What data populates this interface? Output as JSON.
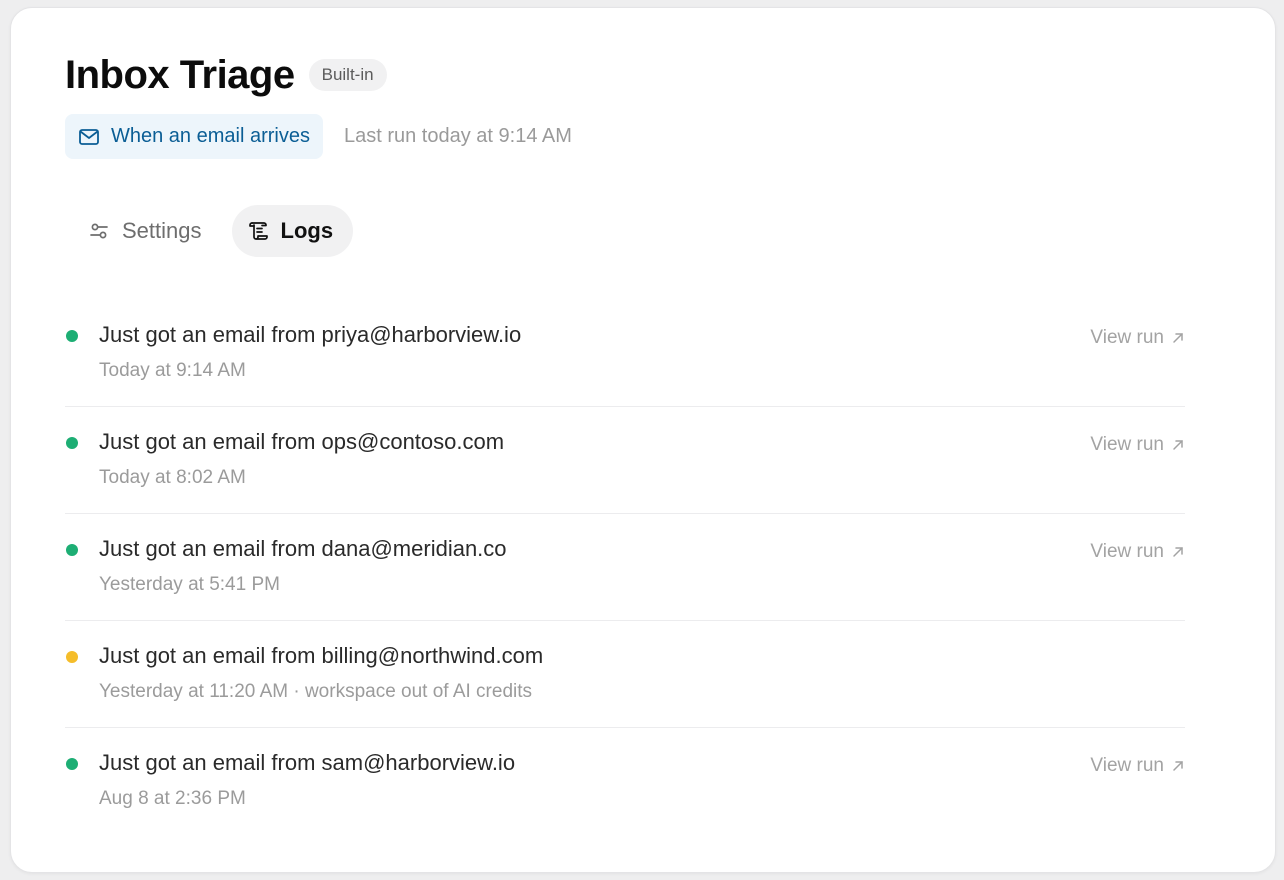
{
  "header": {
    "title": "Inbox Triage",
    "badge": "Built-in"
  },
  "trigger": {
    "icon": "mail-icon",
    "label": "When an email arrives",
    "color": "#0b5e95",
    "background": "#edf5fb"
  },
  "last_run": "Last run today at 9:14 AM",
  "tabs": [
    {
      "label": "Settings",
      "icon": "sliders-icon",
      "active": false
    },
    {
      "label": "Logs",
      "icon": "scroll-icon",
      "active": true
    }
  ],
  "status_colors": {
    "success": "#1dae74",
    "warning": "#f5bd2a"
  },
  "logs": [
    {
      "title": "Just got an email from priya@harborview.io",
      "subtitle": "Today at 9:14 AM",
      "status": "success",
      "action": "View run"
    },
    {
      "title": "Just got an email from ops@contoso.com",
      "subtitle": "Today at 8:02 AM",
      "status": "success",
      "action": "View run"
    },
    {
      "title": "Just got an email from dana@meridian.co",
      "subtitle": "Yesterday at 5:41 PM",
      "status": "success",
      "action": "View run"
    },
    {
      "title": "Just got an email from billing@northwind.com",
      "subtitle": "Yesterday at 11:20 AM · workspace out of AI credits",
      "status": "warning",
      "action": ""
    },
    {
      "title": "Just got an email from sam@harborview.io",
      "subtitle": "Aug 8 at 2:36 PM",
      "status": "success",
      "action": "View run"
    }
  ]
}
